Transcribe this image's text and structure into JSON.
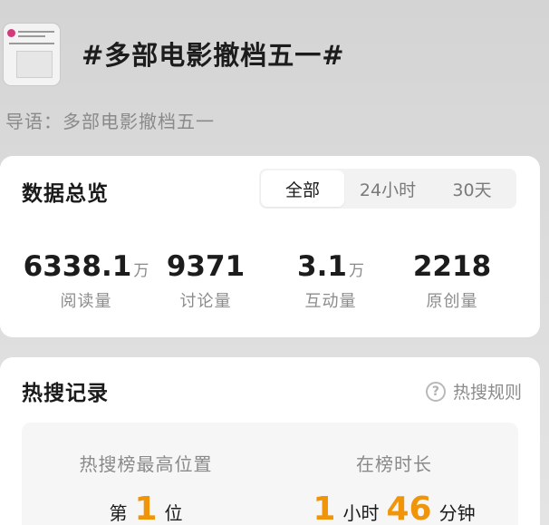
{
  "topic": {
    "title": "#多部电影撤档五一#",
    "guide": "导语：多部电影撤档五一"
  },
  "overview": {
    "title": "数据总览",
    "tabs": [
      {
        "label": "全部",
        "active": true
      },
      {
        "label": "24小时",
        "active": false
      },
      {
        "label": "30天",
        "active": false
      }
    ],
    "stats": [
      {
        "value": "6338.1",
        "unit": "万",
        "label": "阅读量"
      },
      {
        "value": "9371",
        "unit": "",
        "label": "讨论量"
      },
      {
        "value": "3.1",
        "unit": "万",
        "label": "互动量"
      },
      {
        "value": "2218",
        "unit": "",
        "label": "原创量"
      }
    ]
  },
  "hot_search": {
    "title": "热搜记录",
    "rules_label": "热搜规则",
    "highest_label": "热搜榜最高位置",
    "highest_prefix": "第",
    "highest_value": "1",
    "highest_suffix": "位",
    "duration_label": "在榜时长",
    "duration_hours": "1",
    "duration_hours_unit": "小时",
    "duration_minutes": "46",
    "duration_minutes_unit": "分钟"
  },
  "colors": {
    "accent": "#f0940a",
    "muted_text": "#8a8a8a"
  }
}
